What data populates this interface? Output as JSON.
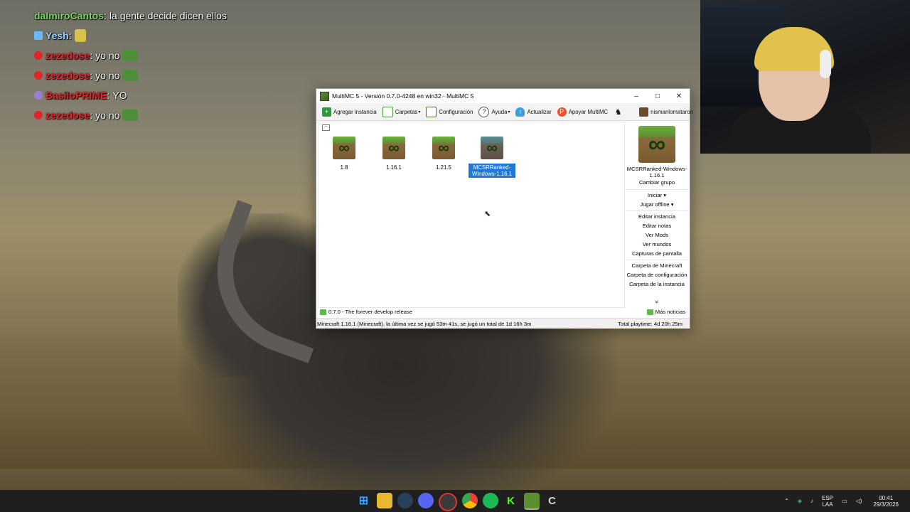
{
  "chat": [
    {
      "user": "dalmiroCantos",
      "sep": ":",
      "message": "la gente decide dicen ellos",
      "color": "#7fd36a",
      "badge": ""
    },
    {
      "user": "Yesh",
      "sep": ":",
      "message": "",
      "color": "#9fd0ff",
      "badge": "sword"
    },
    {
      "user": "zezedose",
      "sep": ":",
      "message": "yo no",
      "color": "#e0242a",
      "badge": "red"
    },
    {
      "user": "zezedose",
      "sep": ":",
      "message": "yo no",
      "color": "#e0242a",
      "badge": "red"
    },
    {
      "user": "BasiloPRIME",
      "sep": ":",
      "message": "YO",
      "color": "#e0242a",
      "badge": "purple"
    },
    {
      "user": "zezedose",
      "sep": ":",
      "message": "yo no",
      "color": "#e0242a",
      "badge": "red"
    }
  ],
  "window": {
    "title": "MultiMC 5 - Versión 0.7.0-4248 en win32 - MultiMC 5",
    "controls": {
      "minimize": "–",
      "maximize": "□",
      "close": "✕"
    }
  },
  "toolbar": {
    "add_instance": "Agregar instancia",
    "folders": "Carpetas",
    "settings": "Configuración",
    "help": "Ayuda",
    "update": "Actualizar",
    "support": "Apoyar MultiMC",
    "account": "nismanlomataron"
  },
  "instances": [
    {
      "name": "1.8",
      "selected": false
    },
    {
      "name": "1.16.1",
      "selected": false
    },
    {
      "name": "1.21.5",
      "selected": false
    },
    {
      "name": "MCSRRanked-Windows-1.16.1",
      "selected": true
    }
  ],
  "sidebar": {
    "selected_name": "MCSRRanked-Windows-1.16.1",
    "change_group": "Cambiar grupo",
    "launch": "Iniciar",
    "play_offline": "Jugar offline",
    "actions": [
      "Editar instancia",
      "Editar notas",
      "Ver Mods",
      "Ver mundos",
      "Capturas de pantalla"
    ],
    "folders": [
      "Carpeta de Minecraft",
      "Carpeta de configuración",
      "Carpeta de la instancia"
    ],
    "more": "»"
  },
  "news": {
    "text": "0.7.0 - The forever develop release",
    "more": "Más noticias"
  },
  "status": {
    "left": "Minecraft 1.16.1 (Minecraft), la última vez se jugó 53m 41s, se jugó un total de 1d 16h 3m",
    "right": "Total playtime: 4d 20h 25m"
  },
  "taskbar": {
    "apps": [
      "start-icon",
      "file-explorer-icon",
      "steam-icon",
      "discord-icon",
      "obs-icon",
      "chrome-icon",
      "spotify-icon",
      "kick-icon",
      "multimc-icon",
      "ccleaner-icon"
    ],
    "lang_top": "ESP",
    "lang_bottom": "LAA",
    "time": "00:41",
    "date": "29/3/2026"
  },
  "colors": {
    "selection": "#1e78d4",
    "taskbar": "#1f1f1f"
  }
}
